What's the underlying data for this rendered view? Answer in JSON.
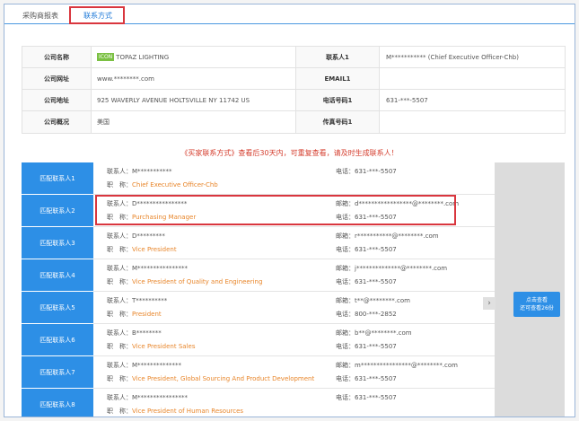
{
  "tabs": [
    {
      "label": "采购商报表"
    },
    {
      "label": "联系方式"
    }
  ],
  "company": {
    "rows": [
      {
        "label": "公司名称",
        "badge": "ICON",
        "value": "TOPAZ LIGHTING",
        "label2": "联系人1",
        "value2": "M*********** (Chief Executive Officer-Chb)"
      },
      {
        "label": "公司网址",
        "value": "www.********.com",
        "label2": "EMAIL1",
        "value2": ""
      },
      {
        "label": "公司地址",
        "value": "925 WAVERLY AVENUE HOLTSVILLE NY 11742 US",
        "label2": "电话号码1",
        "value2": "631-***-5507"
      },
      {
        "label": "公司概况",
        "value": "美国",
        "label2": "传真号码1",
        "value2": ""
      }
    ]
  },
  "notice": "《买家联系方式》查看后30天内，可重复查看，请及时生成联系人！",
  "contacts": [
    {
      "button": "匹配联系人1",
      "name": "联系人：M***********",
      "title_label": "职　称：",
      "title": "Chief Executive Officer-Chb",
      "email": "",
      "phone": "电话：631-***-5507"
    },
    {
      "button": "匹配联系人2",
      "name": "联系人：D****************",
      "title_label": "职　称：",
      "title": "Purchasing Manager",
      "email": "邮箱：d*****************@********.com",
      "phone": "电话：631-***-5507"
    },
    {
      "button": "匹配联系人3",
      "name": "联系人：D*********",
      "title_label": "职　称：",
      "title": "Vice President",
      "email": "邮箱：r***********@********.com",
      "phone": "电话：631-***-5507"
    },
    {
      "button": "匹配联系人4",
      "name": "联系人：M****************",
      "title_label": "职　称：",
      "title": "Vice President of Quality and Engineering",
      "email": "邮箱：j**************@********.com",
      "phone": "电话：631-***-5507"
    },
    {
      "button": "匹配联系人5",
      "name": "联系人：T**********",
      "title_label": "职　称：",
      "title": "President",
      "email": "邮箱：t**@********.com",
      "phone": "电话：800-***-2852"
    },
    {
      "button": "匹配联系人6",
      "name": "联系人：B********",
      "title_label": "职　称：",
      "title": "Vice President Sales",
      "email": "邮箱：b**@********.com",
      "phone": "电话：631-***-5507"
    },
    {
      "button": "匹配联系人7",
      "name": "联系人：M**************",
      "title_label": "职　称：",
      "title": "Vice President, Global Sourcing And Product Development",
      "email": "邮箱：m****************@********.com",
      "phone": "电话：631-***-5507"
    },
    {
      "button": "匹配联系人8",
      "name": "联系人：M****************",
      "title_label": "职　称：",
      "title": "Vice President of Human Resources",
      "email": "",
      "phone": "电话：631-***-5507"
    }
  ],
  "side": {
    "arrow": "›",
    "button_line1": "点击查看",
    "button_line2": "还可查看26份"
  }
}
